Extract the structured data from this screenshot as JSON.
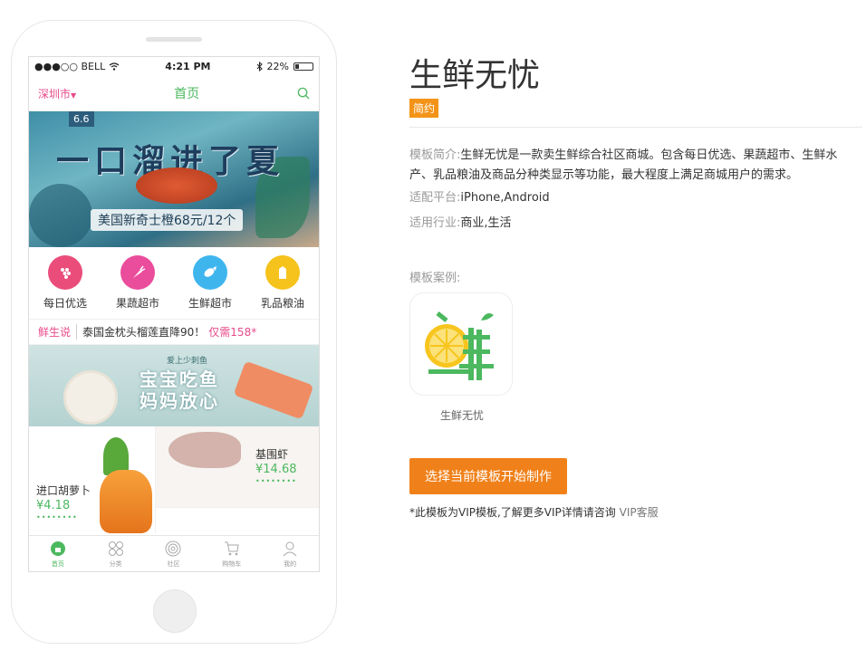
{
  "phone": {
    "statusbar": {
      "carrier": "●●●○○ BELL",
      "time": "4:21 PM",
      "battery": "22%"
    },
    "header": {
      "city": "深圳市",
      "title": "首页"
    },
    "banner": {
      "badge": "6.6",
      "title": "一口溜进了夏",
      "caption": "美国新奇士橙68元/12个"
    },
    "categories": [
      {
        "label": "每日优选",
        "color": "#ea4d7a",
        "icon": "berries-icon"
      },
      {
        "label": "果蔬超市",
        "color": "#ea4d9c",
        "icon": "carrot-icon"
      },
      {
        "label": "生鲜超市",
        "color": "#3fb5ee",
        "icon": "fish-icon"
      },
      {
        "label": "乳品粮油",
        "color": "#f6c21c",
        "icon": "milk-icon"
      }
    ],
    "notice": {
      "tag": "鲜生说",
      "text": "泰国金枕头榴莲直降90！",
      "price": "仅需158*"
    },
    "promo": {
      "top": "爱上少刺鱼",
      "line1": "宝宝吃鱼",
      "line2": "妈妈放心"
    },
    "products": [
      {
        "name": "进口胡萝卜",
        "price": "¥4.18"
      },
      {
        "name": "基围虾",
        "price": "¥14.68"
      }
    ],
    "tabs": [
      {
        "label": "首页",
        "icon": "home-icon",
        "active": true
      },
      {
        "label": "分类",
        "icon": "category-icon",
        "active": false
      },
      {
        "label": "社区",
        "icon": "community-icon",
        "active": false
      },
      {
        "label": "购物车",
        "icon": "cart-icon",
        "active": false
      },
      {
        "label": "我的",
        "icon": "user-icon",
        "active": false
      }
    ]
  },
  "info": {
    "title": "生鲜无忧",
    "tag": "简约",
    "intro_label": "模板简介:",
    "intro_text": "生鲜无忧是一款卖生鲜综合社区商城。包含每日优选、果蔬超市、生鲜水产、乳品粮油及商品分种类显示等功能，最大程度上满足商城用户的需求。",
    "platform_label": "适配平台:",
    "platform_text": "iPhone,Android",
    "industry_label": "适用行业:",
    "industry_text": "商业,生活",
    "cases_label": "模板案例:",
    "case_caption": "生鲜无忧",
    "cta": "选择当前模板开始制作",
    "vip_note": "*此模板为VIP模板,了解更多VIP详情请咨询",
    "vip_link": "VIP客服",
    "colors": {
      "accent_orange": "#f0811a",
      "tag_orange": "#f39419",
      "brand_green": "#4cb85f",
      "brand_pink": "#e84b8a"
    }
  }
}
